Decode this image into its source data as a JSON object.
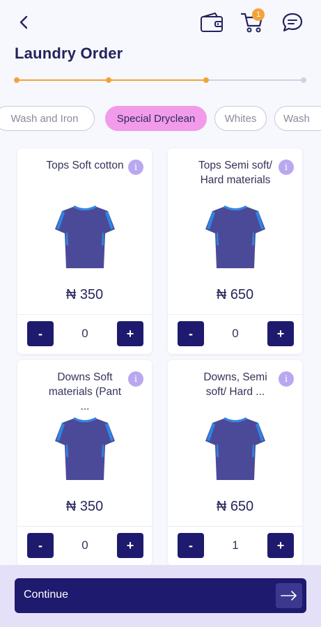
{
  "header": {
    "title": "Laundry Order",
    "cart_count": "1",
    "icons": [
      "back-arrow-icon",
      "wallet-icon",
      "cart-icon",
      "chat-icon"
    ]
  },
  "progress": {
    "steps_total": 4,
    "steps_completed": 3,
    "active_color": "#f5a23a",
    "inactive_color": "#cfd2e3"
  },
  "categories": {
    "items": [
      "Wash and Iron",
      "Special Dryclean",
      "Whites",
      "Wash"
    ],
    "selected": "Special Dryclean"
  },
  "products": [
    {
      "name": "Tops Soft cotton",
      "price": "₦ 350",
      "quantity": "0"
    },
    {
      "name": "Tops Semi soft/ Hard materials",
      "price": "₦ 650",
      "quantity": "0"
    },
    {
      "name": "Downs Soft materials (Pant ...",
      "price": "₦ 350",
      "quantity": "0"
    },
    {
      "name": "Downs, Semi soft/ Hard ...",
      "price": "₦ 650",
      "quantity": "1"
    }
  ],
  "controls": {
    "minus": "-",
    "plus": "+",
    "info": "i"
  },
  "footer": {
    "continue_label": "Continue"
  },
  "colors": {
    "primary": "#1e1a6e",
    "accent": "#f5a23a",
    "selected_tab": "#f29bea",
    "info": "#b9a8f0"
  }
}
